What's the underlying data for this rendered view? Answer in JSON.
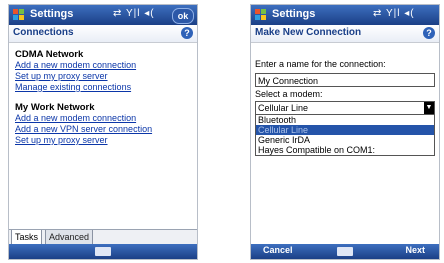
{
  "left_screen": {
    "title": "Settings",
    "status_icons": "⇄ Y|l ◂(",
    "ok_label": "ok",
    "header": "Connections",
    "help_label": "?",
    "sections": [
      {
        "title": "CDMA Network",
        "links": [
          "Add a new modem connection",
          "Set up my proxy server",
          "Manage existing connections"
        ]
      },
      {
        "title": "My Work Network",
        "links": [
          "Add a new modem connection",
          "Add a new VPN server connection",
          "Set up my proxy server"
        ]
      }
    ],
    "tabs": [
      "Tasks",
      "Advanced"
    ]
  },
  "right_screen": {
    "title": "Settings",
    "status_icons": "⇄ Y|l ◂(",
    "header": "Make New Connection",
    "help_label": "?",
    "name_label": "Enter a name for the connection:",
    "name_value": "My Connection",
    "modem_label": "Select a modem:",
    "modem_selected": "Cellular Line",
    "modem_options": [
      "Bluetooth",
      "Cellular Line",
      "Generic IrDA",
      "Hayes Compatible on COM1:"
    ],
    "modem_highlighted": "Cellular Line",
    "softkey_left": "Cancel",
    "softkey_right": "Next"
  },
  "icons": [
    "windows-start-icon",
    "sync-icon",
    "signal-icon",
    "volume-icon",
    "help-icon",
    "keyboard-icon",
    "dropdown-arrow-icon"
  ],
  "colors": {
    "titlebar": "#1b3f86",
    "link": "#0b36a8",
    "selection": "#2454a9"
  }
}
